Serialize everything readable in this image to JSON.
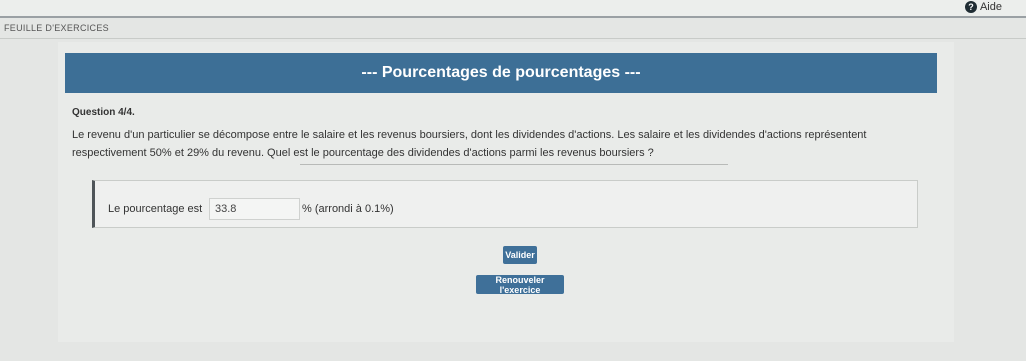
{
  "header": {
    "help_label": "Aide",
    "help_icon_glyph": "?",
    "breadcrumb": "FEUILLE D'EXERCICES"
  },
  "exercise": {
    "title": "--- Pourcentages de pourcentages ---",
    "question_number": "Question 4/4.",
    "question_text": "Le revenu d'un particulier se décompose entre le salaire et les revenus boursiers, dont les dividendes d'actions. Les salaire et les dividendes d'actions représentent respectivement 50% et 29% du revenu. Quel est le pourcentage des dividendes d'actions parmi les revenus boursiers ?"
  },
  "answer": {
    "label": "Le pourcentage est",
    "value": "33.8",
    "suffix": "% (arrondi à 0.1%)"
  },
  "buttons": {
    "validate": "Valider",
    "renew": "Renouveler l'exercice"
  },
  "colors": {
    "title_bar": "#3d6f96",
    "button": "#3f7099",
    "background": "#e4e6e4"
  }
}
